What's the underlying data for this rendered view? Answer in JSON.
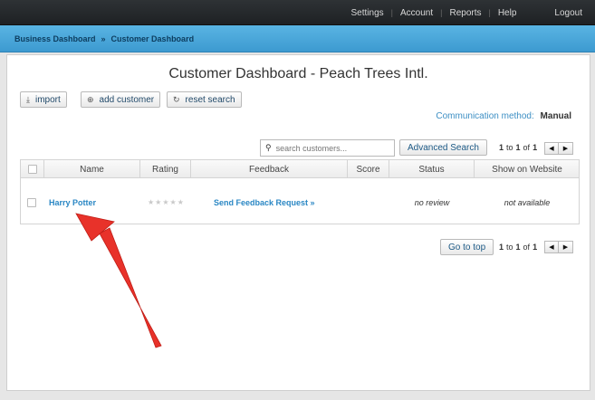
{
  "topnav": {
    "items": [
      {
        "label": "Settings"
      },
      {
        "label": "Account"
      },
      {
        "label": "Reports"
      },
      {
        "label": "Help"
      }
    ],
    "separator": "|",
    "logout": "Logout"
  },
  "breadcrumb": {
    "items": [
      "Business Dashboard",
      "Customer Dashboard"
    ],
    "separator": "»"
  },
  "page": {
    "title": "Customer Dashboard - Peach Trees Intl."
  },
  "actions": {
    "import": "import",
    "add_customer": "add customer",
    "reset_search": "reset search"
  },
  "communication": {
    "label": "Communication method:",
    "value": "Manual"
  },
  "search": {
    "placeholder": "search customers...",
    "advanced": "Advanced Search"
  },
  "pagination": {
    "from": "1",
    "to_word": "to",
    "to": "1",
    "of_word": "of",
    "total": "1"
  },
  "table": {
    "columns": [
      "Name",
      "Rating",
      "Feedback",
      "Score",
      "Status",
      "Show on Website"
    ],
    "rows": [
      {
        "name": "Harry Potter",
        "rating_stars": "★★★★★",
        "feedback": "Send Feedback Request »",
        "score": "",
        "status": "no review",
        "show_on_website": "not available"
      }
    ]
  },
  "footer": {
    "goto_top": "Go to top"
  },
  "colors": {
    "topbar": "#1e2124",
    "bluebar": "#4aa8dc",
    "link": "#2a87c4",
    "annotation_arrow": "#e8322a"
  },
  "icons": {
    "import": "download-icon",
    "add_customer": "plus-circle-icon",
    "reset_search": "refresh-icon",
    "search": "magnifier-icon",
    "prev": "triangle-left-icon",
    "next": "triangle-right-icon"
  }
}
